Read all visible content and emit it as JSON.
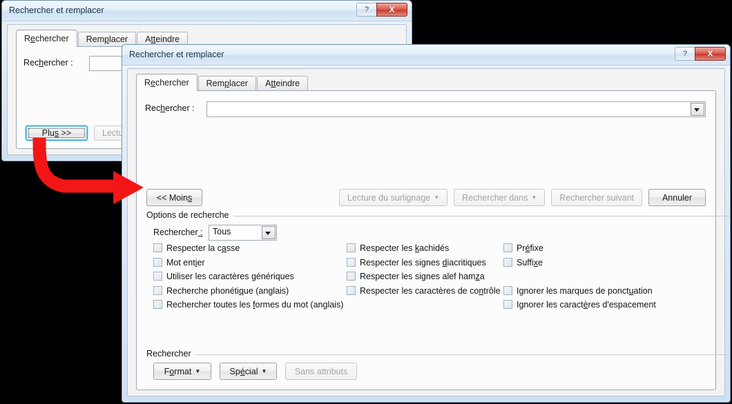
{
  "accent": {
    "red_arrow": "#f21616",
    "focus_blue": "#2e9fd6",
    "close_red": "#c8392c"
  },
  "back_dialog": {
    "title": "Rechercher et remplacer",
    "help_label": "?",
    "close_label": "X",
    "tabs": [
      {
        "label_pre": "R",
        "label_ak": "e",
        "label_post": "chercher",
        "active": true
      },
      {
        "label_pre": "Rem",
        "label_ak": "p",
        "label_post": "lacer",
        "active": false
      },
      {
        "label_pre": "A",
        "label_ak": "tt",
        "label_post": "eindre",
        "active": false
      }
    ],
    "find_label_pre": "Rec",
    "find_label_ak": "h",
    "find_label_post": "ercher :",
    "find_value": "",
    "buttons": {
      "more": {
        "pre": "Plu",
        "ak": "s",
        "post": " >>"
      },
      "read_highlight": "Lecture du"
    }
  },
  "front_dialog": {
    "title": "Rechercher et remplacer",
    "help_label": "?",
    "close_label": "X",
    "tabs": [
      {
        "label_pre": "R",
        "label_ak": "e",
        "label_post": "chercher",
        "active": true
      },
      {
        "label_pre": "Rem",
        "label_ak": "p",
        "label_post": "lacer",
        "active": false
      },
      {
        "label_pre": "A",
        "label_ak": "tt",
        "label_post": "eindre",
        "active": false
      }
    ],
    "find_label_pre": "Rec",
    "find_label_ak": "h",
    "find_label_post": "ercher :",
    "find_value": "",
    "find_placeholder": "",
    "action_buttons": [
      {
        "name": "less",
        "pre": "<< Moin",
        "ak": "s",
        "post": "",
        "disabled": false,
        "caret": false
      },
      {
        "name": "read-highlight",
        "pre": "Lecture du surlignage",
        "ak": "",
        "post": "",
        "disabled": true,
        "caret": true
      },
      {
        "name": "find-in",
        "pre": "Rechercher dans",
        "ak": "",
        "post": "",
        "disabled": true,
        "caret": true
      },
      {
        "name": "find-next",
        "pre": "Rechercher suivant",
        "ak": "",
        "post": "",
        "disabled": true,
        "caret": false
      },
      {
        "name": "cancel",
        "pre": "Annuler",
        "ak": "",
        "post": "",
        "disabled": false,
        "caret": false
      }
    ],
    "search_options_group": "Options de recherche",
    "scope": {
      "label_pre": "Rechercher",
      "label_ak": " :",
      "label_post": "",
      "value": "Tous",
      "options": [
        "Tous"
      ]
    },
    "checkbox_col1": [
      {
        "pre": "Respecter la c",
        "ak": "a",
        "post": "sse",
        "checked": false
      },
      {
        "pre": "Mot ent",
        "ak": "i",
        "post": "er",
        "checked": false
      },
      {
        "pre": "Utiliser les caractères ",
        "ak": "g",
        "post": "énériques",
        "checked": false
      },
      {
        "pre": "Recherche phonéti",
        "ak": "q",
        "post": "ue (anglais)",
        "checked": false
      },
      {
        "pre": "Rechercher toutes les ",
        "ak": "f",
        "post": "ormes du mot (anglais)",
        "checked": false
      }
    ],
    "checkbox_col2": [
      {
        "pre": "Respecter les ",
        "ak": "k",
        "post": "achidés",
        "checked": false
      },
      {
        "pre": "Respecter les signes ",
        "ak": "d",
        "post": "iacritiques",
        "checked": false
      },
      {
        "pre": "Respecter les signes alef ham",
        "ak": "z",
        "post": "a",
        "checked": false
      },
      {
        "pre": "Respecter les caractères de co",
        "ak": "n",
        "post": "trôle",
        "checked": false
      }
    ],
    "checkbox_col3": [
      {
        "pre": "Pr",
        "ak": "é",
        "post": "fixe",
        "checked": false,
        "row": 0
      },
      {
        "pre": "Suffi",
        "ak": "x",
        "post": "e",
        "checked": false,
        "row": 1
      },
      {
        "pre": "Ignorer les marques de ponct",
        "ak": "u",
        "post": "ation",
        "checked": false,
        "row": 3
      },
      {
        "pre": "Ignorer les caract",
        "ak": "è",
        "post": "res d'espacement",
        "checked": false,
        "row": 4
      }
    ],
    "find_group": "Rechercher",
    "bottom_buttons": [
      {
        "name": "format",
        "pre": "F",
        "ak": "o",
        "post": "rmat",
        "disabled": false,
        "caret": true
      },
      {
        "name": "special",
        "pre": "Sp",
        "ak": "é",
        "post": "cial",
        "disabled": false,
        "caret": true
      },
      {
        "name": "no-formatting",
        "pre": "Sans attributs",
        "ak": "",
        "post": "",
        "disabled": true,
        "caret": false
      }
    ]
  },
  "annotation": {
    "arrow_name": "red-curved-arrow"
  }
}
